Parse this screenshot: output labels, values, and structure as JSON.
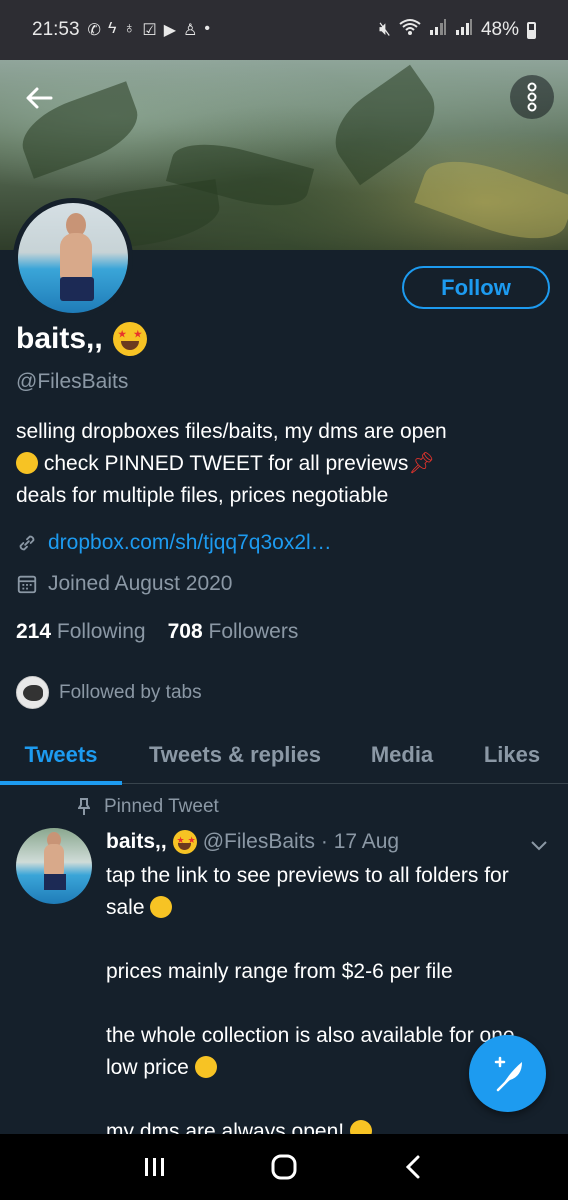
{
  "status": {
    "time": "21:53",
    "battery": "48%",
    "battery_level": 0.48,
    "left_icons": [
      "whatsapp-icon",
      "bolt-icon",
      "playstation-icon",
      "check-box-icon",
      "youtube-icon",
      "person-icon",
      "dot-icon"
    ],
    "right_icons": [
      "mute-icon",
      "wifi-icon",
      "signal-icon",
      "signal-icon"
    ]
  },
  "profile": {
    "name": "baits,,",
    "name_emoji": "star-struck-emoji",
    "handle": "@FilesBaits",
    "follow_label": "Follow",
    "bio_line1": "selling dropboxes files/baits, my dms are open",
    "bio_line2": "check PINNED TWEET for all previews",
    "bio_line3": "deals for multiple files, prices negotiable",
    "link": "dropbox.com/sh/tjqq7q3ox2l…",
    "joined": "Joined August 2020",
    "following_count": "214",
    "following_label": "Following",
    "followers_count": "708",
    "followers_label": "Followers",
    "followed_by": "Followed by tabs"
  },
  "tabs": [
    {
      "label": "Tweets",
      "active": true
    },
    {
      "label": "Tweets & replies",
      "active": false
    },
    {
      "label": "Media",
      "active": false
    },
    {
      "label": "Likes",
      "active": false
    }
  ],
  "tweet": {
    "pinned_label": "Pinned Tweet",
    "name": "baits,,",
    "handle_date": "@FilesBaits · 17 Aug",
    "text_part1": "tap the link to see previews to all folders for sale",
    "text_part2": "prices mainly range from $2-6 per file",
    "text_part3": "the whole collection is also available for one low price",
    "text_part4": "my dms are always open!"
  },
  "colors": {
    "background": "#15202b",
    "accent": "#1d9bf0",
    "secondary_text": "#8b98a5"
  }
}
